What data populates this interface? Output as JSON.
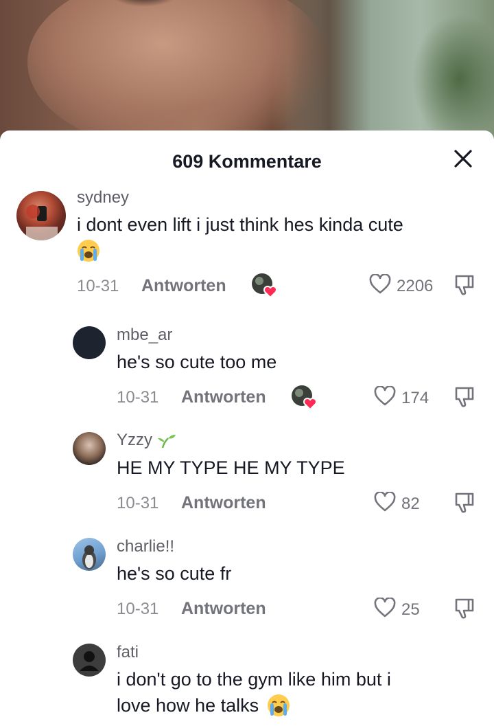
{
  "header": {
    "title": "609 Kommentare"
  },
  "comments": [
    {
      "username": "sydney",
      "text_line1": "i dont even lift i just think hes kinda cute",
      "emoji": "loudly-crying-face",
      "date": "10-31",
      "reply_label": "Antworten",
      "likes": "2206",
      "creator_liked": true
    },
    {
      "username": "mbe_ar",
      "text_line1": "he's so cute too me",
      "date": "10-31",
      "reply_label": "Antworten",
      "likes": "174",
      "creator_liked": true
    },
    {
      "username": "Yzzy",
      "username_icon": "seedling-icon",
      "text_line1": "HE MY TYPE HE MY TYPE",
      "date": "10-31",
      "reply_label": "Antworten",
      "likes": "82"
    },
    {
      "username": "charlie!!",
      "text_line1": "he's so cute fr",
      "date": "10-31",
      "reply_label": "Antworten",
      "likes": "25"
    },
    {
      "username": "fati",
      "text_line1": "i don't go to the gym like him but i",
      "text_line2": "love how he talks",
      "emoji": "loudly-crying-face"
    }
  ],
  "colors": {
    "heart_red": "#fe2c55",
    "text": "#161823",
    "muted": "#73747b"
  }
}
